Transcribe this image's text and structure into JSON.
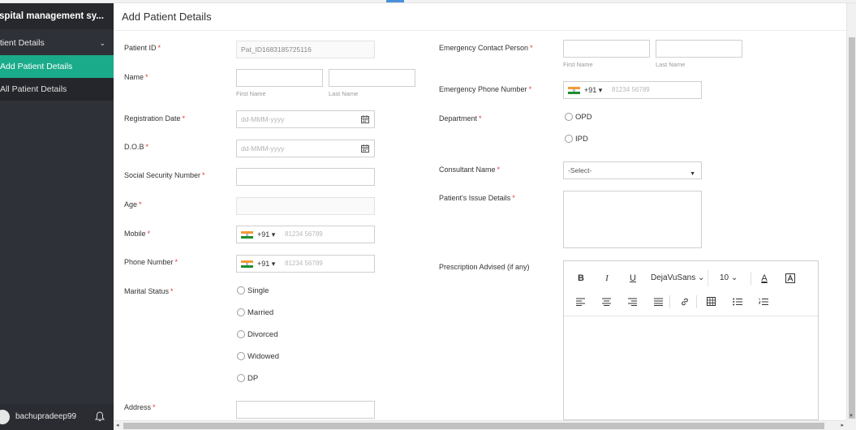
{
  "app": {
    "title": "ospital management sy..."
  },
  "sidebar": {
    "group_label": "atient Details",
    "items": [
      {
        "label": "Add Patient Details",
        "active": true
      },
      {
        "label": "All Patient Details",
        "active": false
      }
    ],
    "user": "bachupradeep99"
  },
  "page": {
    "title": "Add Patient Details"
  },
  "form": {
    "required_mark": "*",
    "patient_id": {
      "label": "Patient ID",
      "value": "Pat_ID1683185725116"
    },
    "name": {
      "label": "Name",
      "first_sub": "First Name",
      "last_sub": "Last Name"
    },
    "registration_date": {
      "label": "Registration Date",
      "placeholder": "dd-MMM-yyyy"
    },
    "dob": {
      "label": "D.O.B",
      "placeholder": "dd-MMM-yyyy"
    },
    "ssn": {
      "label": "Social Security Number"
    },
    "age": {
      "label": "Age"
    },
    "mobile": {
      "label": "Mobile",
      "code": "+91 ▾",
      "placeholder": "81234 56789"
    },
    "phone_number": {
      "label": "Phone Number",
      "code": "+91 ▾",
      "placeholder": "81234 56789"
    },
    "marital_status": {
      "label": "Marital Status",
      "options": [
        "Single",
        "Married",
        "Divorced",
        "Widowed",
        "DP"
      ]
    },
    "address": {
      "label": "Address"
    },
    "emergency_contact": {
      "label": "Emergency Contact Person",
      "first_sub": "First Name",
      "last_sub": "Last Name"
    },
    "emergency_phone": {
      "label": "Emergency Phone Number",
      "code": "+91 ▾",
      "placeholder": "81234 56789"
    },
    "department": {
      "label": "Department",
      "options": [
        "OPD",
        "IPD"
      ]
    },
    "consultant": {
      "label": "Consultant Name",
      "value": "-Select-"
    },
    "issue_details": {
      "label": "Patient's Issue Details"
    },
    "prescription": {
      "label": "Prescription Advised (if any)"
    }
  },
  "editor": {
    "bold": "B",
    "italic": "I",
    "underline": "U",
    "font": "DejaVuSans ⌄",
    "size": "10 ⌄",
    "font_color": "A"
  },
  "colors": {
    "sidebar_bg": "#2f3138",
    "active_item": "#1aab8a",
    "required": "#e03a3a"
  },
  "icons": [
    "chevron-down-icon",
    "calendar-icon",
    "india-flag-icon",
    "bell-icon",
    "caret-down-icon"
  ]
}
